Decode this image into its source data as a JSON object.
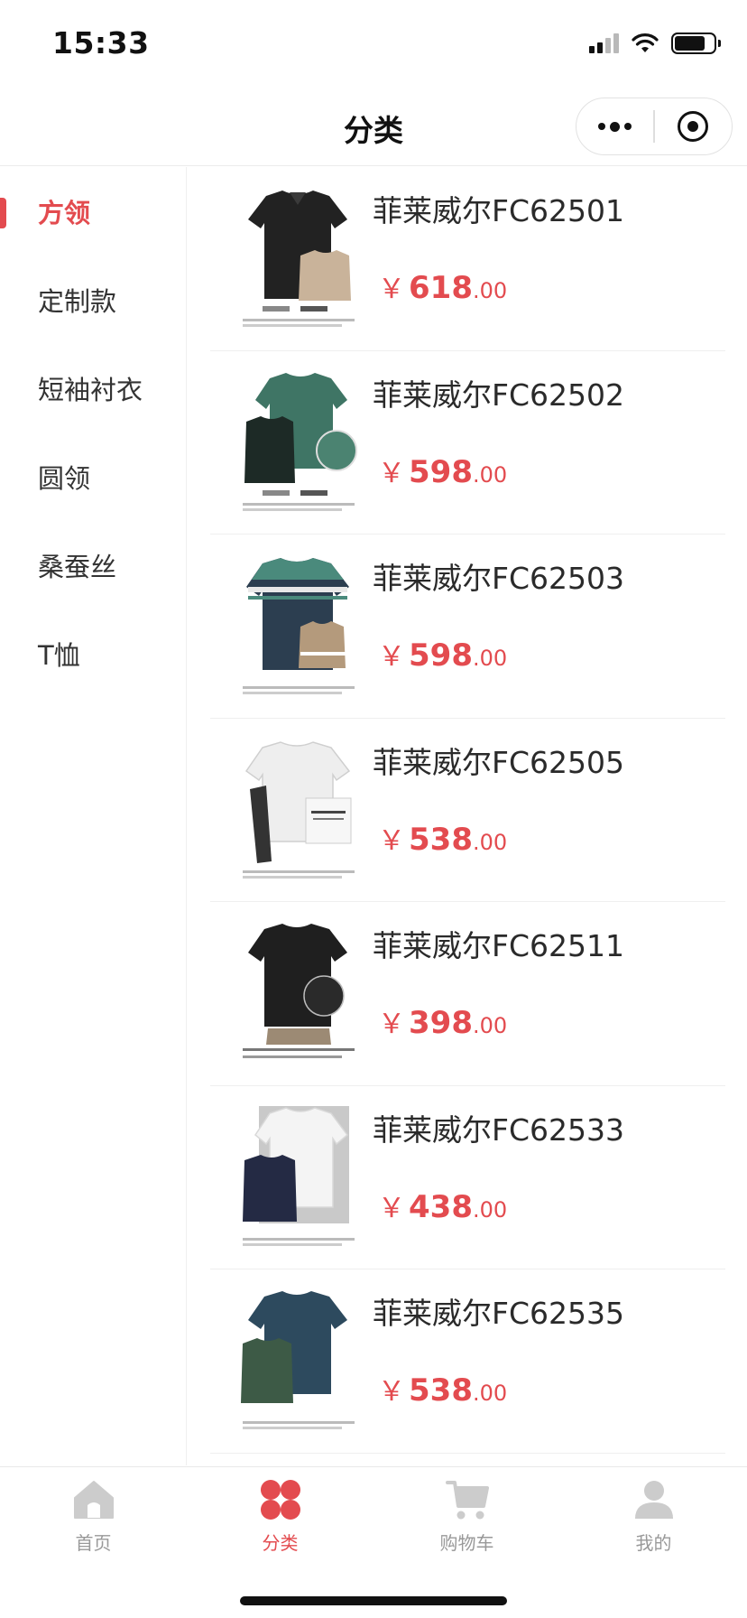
{
  "status_bar": {
    "time": "15:33"
  },
  "nav": {
    "title": "分类"
  },
  "sidebar": {
    "items": [
      {
        "label": "方领",
        "active": true
      },
      {
        "label": "定制款",
        "active": false
      },
      {
        "label": "短袖衬衣",
        "active": false
      },
      {
        "label": "圆领",
        "active": false
      },
      {
        "label": "桑蚕丝",
        "active": false
      },
      {
        "label": "T恤",
        "active": false
      }
    ]
  },
  "products": [
    {
      "name": "菲莱威尔FC62501",
      "currency": "￥",
      "price_int": "618",
      "price_dec": ".00",
      "image": "shirt-black-with-khaki"
    },
    {
      "name": "菲莱威尔FC62502",
      "currency": "￥",
      "price_int": "598",
      "price_dec": ".00",
      "image": "shirt-teal-with-black"
    },
    {
      "name": "菲莱威尔FC62503",
      "currency": "￥",
      "price_int": "598",
      "price_dec": ".00",
      "image": "shirt-teal-navy-stripe"
    },
    {
      "name": "菲莱威尔FC62505",
      "currency": "￥",
      "price_int": "538",
      "price_dec": ".00",
      "image": "shirt-white"
    },
    {
      "name": "菲莱威尔FC62511",
      "currency": "￥",
      "price_int": "398",
      "price_dec": ".00",
      "image": "shirt-black"
    },
    {
      "name": "菲莱威尔FC62533",
      "currency": "￥",
      "price_int": "438",
      "price_dec": ".00",
      "image": "shirt-white-with-navy"
    },
    {
      "name": "菲莱威尔FC62535",
      "currency": "￥",
      "price_int": "538",
      "price_dec": ".00",
      "image": "shirt-navy-with-green"
    }
  ],
  "tab_bar": {
    "tabs": [
      {
        "label": "首页",
        "icon": "home-icon",
        "active": false
      },
      {
        "label": "分类",
        "icon": "category-icon",
        "active": true
      },
      {
        "label": "购物车",
        "icon": "cart-icon",
        "active": false
      },
      {
        "label": "我的",
        "icon": "user-icon",
        "active": false
      }
    ]
  },
  "colors": {
    "accent": "#e34b4f",
    "inactive": "#999999",
    "icon_inactive": "#cccccc"
  }
}
